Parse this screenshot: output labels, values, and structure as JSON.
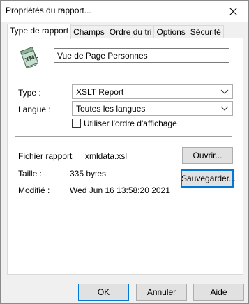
{
  "window": {
    "title": "Propriétés du rapport..."
  },
  "tabs": [
    {
      "label": "Type de rapport",
      "active": true
    },
    {
      "label": "Champs",
      "active": false
    },
    {
      "label": "Ordre du tri",
      "active": false
    },
    {
      "label": "Options",
      "active": false
    },
    {
      "label": "Sécurité",
      "active": false
    }
  ],
  "report": {
    "name": "Vue de Page Personnes",
    "icon": "xml-document-icon"
  },
  "type": {
    "label": "Type :",
    "value": "XSLT Report"
  },
  "language": {
    "label": "Langue :",
    "value": "Toutes les langues"
  },
  "display_order": {
    "label": "Utiliser l'ordre d'affichage",
    "checked": false
  },
  "file": {
    "label": "Fichier rapport",
    "value": "xmldata.xsl",
    "size_label": "Taille :",
    "size_value": "335 bytes",
    "modified_label": "Modifié :",
    "modified_value": "Wed Jun 16 13:58:20 2021"
  },
  "buttons": {
    "open": "Ouvrir...",
    "save": "Sauvegarder...",
    "ok": "OK",
    "cancel": "Annuler",
    "help": "Aide"
  }
}
